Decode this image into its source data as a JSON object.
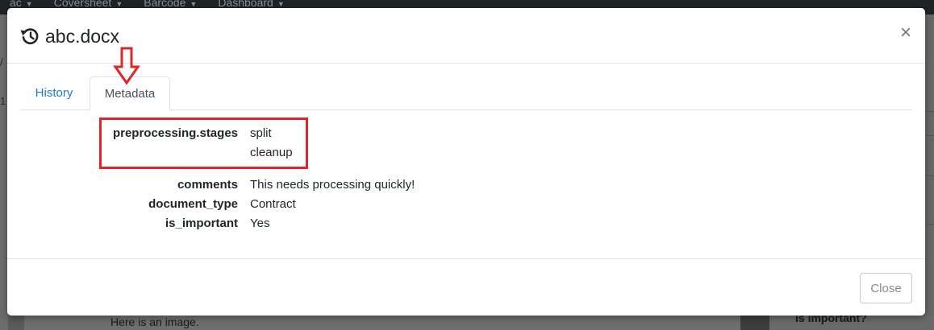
{
  "background": {
    "nav_items": [
      "ac",
      "Coversheet",
      "Barcode",
      "Dashboard"
    ],
    "left_marks": [
      "/",
      "1"
    ],
    "right_text": "g",
    "bottom_text": "Here is an image.",
    "bottom_right_text": "is important?"
  },
  "modal": {
    "title": "abc.docx",
    "title_icon": "history-icon",
    "close_glyph": "×",
    "tabs": [
      {
        "label": "History",
        "active": false
      },
      {
        "label": "Metadata",
        "active": true
      }
    ],
    "metadata": {
      "stages_key": "preprocessing.stages",
      "stages_values": [
        "split",
        "cleanup"
      ],
      "rows": [
        {
          "key": "comments",
          "value": "This needs processing quickly!"
        },
        {
          "key": "document_type",
          "value": "Contract"
        },
        {
          "key": "is_important",
          "value": "Yes"
        }
      ]
    },
    "close_button_label": "Close"
  },
  "colors": {
    "annotation_red": "#e0242a",
    "link_blue": "#1a7ad3"
  }
}
